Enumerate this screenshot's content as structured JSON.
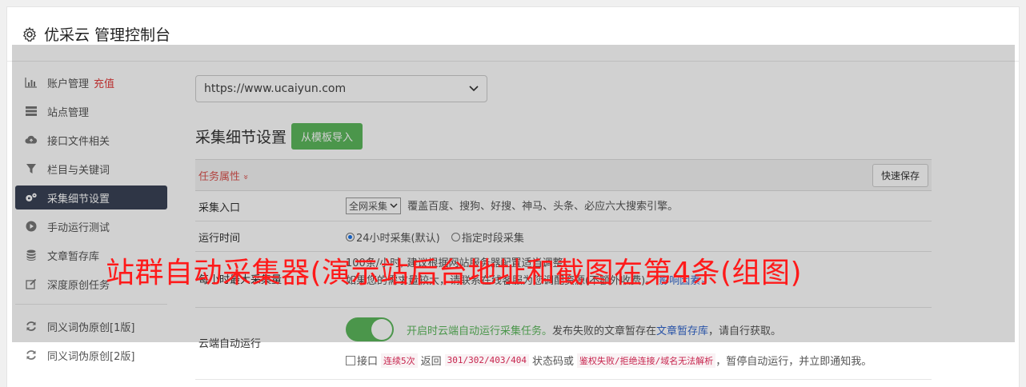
{
  "header": {
    "title": "优采云 管理控制台"
  },
  "sidebar": {
    "items": [
      {
        "label": "账户管理",
        "extra": "充值",
        "icon": "bar-chart-icon"
      },
      {
        "label": "站点管理",
        "icon": "server-icon"
      },
      {
        "label": "接口文件相关",
        "icon": "cloud-upload-icon"
      },
      {
        "label": "栏目与关键词",
        "icon": "filter-icon"
      },
      {
        "label": "采集细节设置",
        "icon": "gears-icon",
        "active": true
      },
      {
        "label": "手动运行测试",
        "icon": "play-circle-icon"
      },
      {
        "label": "文章暂存库",
        "icon": "database-icon"
      },
      {
        "label": "深度原创任务",
        "icon": "edit-icon"
      },
      {
        "label": "同义词伪原创[1版]",
        "icon": "refresh-icon"
      },
      {
        "label": "同义词伪原创[2版]",
        "icon": "refresh-icon"
      }
    ]
  },
  "main": {
    "site_select": "https://www.ucaiyun.com",
    "section_title": "采集细节设置",
    "import_button": "从模板导入",
    "task_tab": "任务属性",
    "task_tab_arrow": "»",
    "quick_save": "快速保存",
    "rows": {
      "entry": {
        "label": "采集入口",
        "select": "全网采集",
        "desc": "覆盖百度、搜狗、好搜、神马、头条、必应六大搜索引擎。"
      },
      "runtime": {
        "label": "运行时间",
        "opt1": "24小时采集(默认)",
        "opt2": "指定时段采集"
      },
      "limit": {
        "label": "每小时最大采集量",
        "line1": "100条/小时, 建议根据网站服务器配置适当调整。",
        "line2": "如果您的需求量较大，请联系在线客服为您调配资源(不额外收费)。",
        "link": "影响因素",
        "link_arrow": "»"
      },
      "cloud": {
        "label": "云端自动运行",
        "enabled_text": "开启时云端自动运行采集任务。",
        "text2": "发布失败的文章暂存在",
        "link": "文章暂存库",
        "text3": "，请自行获取。",
        "check_label": "接口",
        "code1": "连续5次",
        "text4": "返回",
        "code2": "301/302/403/404",
        "text5": "状态码或",
        "code3": "鉴权失败/拒绝连接/域名无法解析",
        "text6": "，暂停自动运行，并立即通知我。"
      }
    }
  },
  "watermark": "站群自动采集器(演示站后台地址和截图在第4条(组图)",
  "colors": {
    "accent_green": "#5cb85c",
    "active_nav": "#3a4356",
    "watermark_red": "#ff1a1a",
    "task_red": "#d9534f"
  }
}
